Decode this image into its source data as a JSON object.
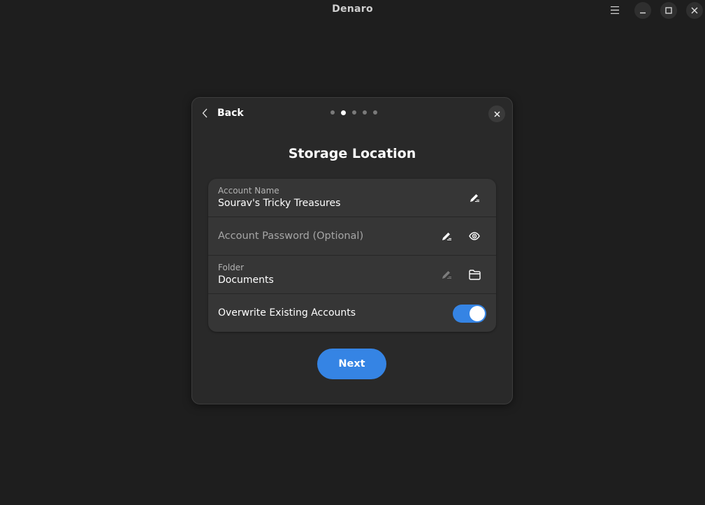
{
  "window": {
    "title": "Denaro",
    "menu_icon": "hamburger-menu-icon",
    "minimize_icon": "minimize-icon",
    "maximize_icon": "maximize-icon",
    "close_icon": "close-icon"
  },
  "dialog": {
    "back_label": "Back",
    "page_indicator": {
      "total": 5,
      "active_index": 1
    },
    "title": "Storage Location",
    "fields": {
      "account_name": {
        "label": "Account Name",
        "value": "Sourav's Tricky Treasures",
        "edit_icon": "pencil-icon"
      },
      "account_password": {
        "placeholder": "Account Password (Optional)",
        "edit_icon": "pencil-icon",
        "reveal_icon": "eye-icon"
      },
      "folder": {
        "label": "Folder",
        "value": "Documents",
        "edit_icon": "pencil-icon",
        "browse_icon": "folder-icon"
      },
      "overwrite": {
        "label": "Overwrite Existing Accounts",
        "enabled": true
      }
    },
    "next_label": "Next"
  },
  "colors": {
    "accent": "#3584e4",
    "background": "#1e1e1e",
    "dialog_bg": "#292929",
    "card_bg": "#363636"
  }
}
